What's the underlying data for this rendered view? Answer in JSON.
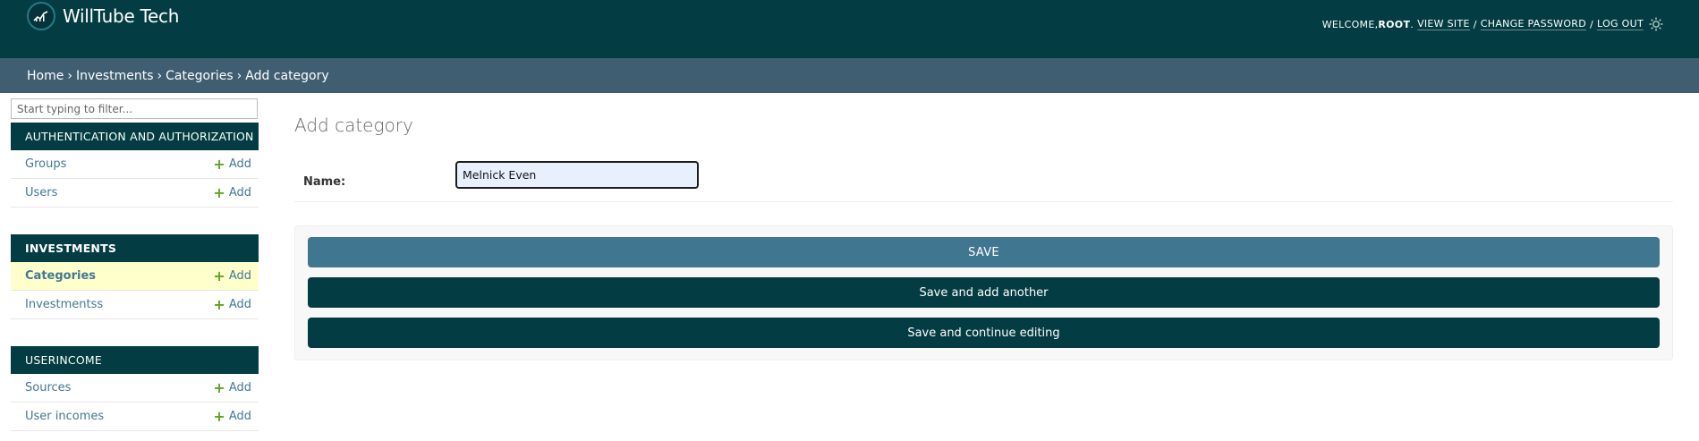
{
  "header": {
    "brand": "WillTube Tech",
    "welcome_prefix": "WELCOME, ",
    "username": "ROOT",
    "welcome_suffix": ".",
    "view_site": "View site",
    "change_password": "Change password",
    "log_out": "Log out",
    "separator": "/"
  },
  "breadcrumbs": {
    "items": [
      "Home",
      "Investments",
      "Categories"
    ],
    "current": "Add category",
    "arrow": "›"
  },
  "sidebar": {
    "filter_placeholder": "Start typing to filter...",
    "add_label": "Add",
    "modules": [
      {
        "name": "Authentication and Authorization",
        "items": [
          "Groups",
          "Users"
        ]
      },
      {
        "name": "Investments",
        "items": [
          "Categories",
          "Investmentss"
        ]
      },
      {
        "name": "Userincome",
        "items": [
          "Sources",
          "User incomes"
        ]
      }
    ]
  },
  "main": {
    "title": "Add category",
    "name_label": "Name:",
    "name_value": "Melnick Even",
    "save": "Save",
    "save_add_another": "Save and add another",
    "save_continue": "Save and continue editing"
  },
  "colors": {
    "header_bg": "#033c42",
    "breadcrumb_bg": "#3f5e72",
    "save_button": "#417690",
    "secondary_button": "#033c42",
    "link": "#417893",
    "add_plus": "#5fa225",
    "current_row": "#ffffcc"
  }
}
